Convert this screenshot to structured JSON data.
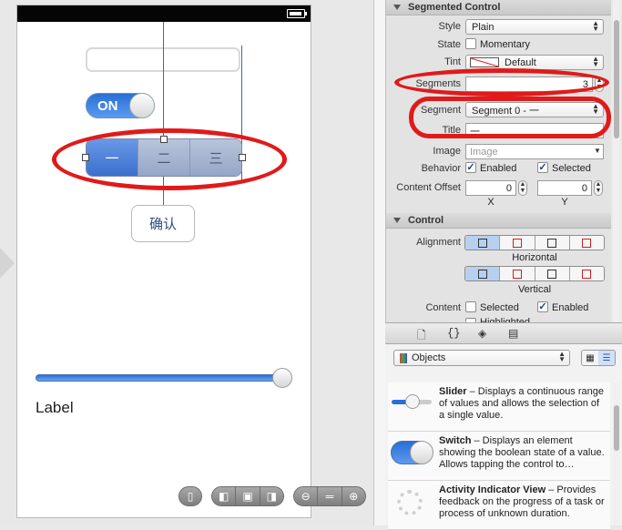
{
  "canvas": {
    "textfield_value": "",
    "switch_label": "ON",
    "segments": [
      "一",
      "二",
      "三"
    ],
    "selected_segment": 0,
    "confirm_label": "确认",
    "slider_value": 1.0,
    "label_text": "Label"
  },
  "zoom_bar": {
    "groups": [
      [
        "device-icon"
      ],
      [
        "layout-left-icon",
        "layout-fit-icon",
        "layout-right-icon"
      ],
      [
        "zoom-out-icon",
        "zoom-actual-icon",
        "zoom-in-icon"
      ]
    ]
  },
  "inspector": {
    "segmented_section": "Segmented Control",
    "style_label": "Style",
    "style_value": "Plain",
    "state_label": "State",
    "momentary_label": "Momentary",
    "tint_label": "Tint",
    "tint_value": "Default",
    "segments_label": "Segments",
    "segments_value": "3",
    "segment_label": "Segment",
    "segment_value": "Segment 0 - 一",
    "title_label": "Title",
    "title_value": "一",
    "image_label": "Image",
    "image_placeholder": "Image",
    "behavior_label": "Behavior",
    "enabled_label": "Enabled",
    "selected_label": "Selected",
    "content_offset_label": "Content Offset",
    "offset_x": "0",
    "offset_y": "0",
    "x_label": "X",
    "y_label": "Y",
    "control_section": "Control",
    "alignment_label": "Alignment",
    "horizontal_label": "Horizontal",
    "vertical_label": "Vertical",
    "content_label": "Content",
    "content_selected_label": "Selected",
    "content_enabled_label": "Enabled",
    "content_highlighted_label": "Highlighted"
  },
  "library": {
    "objects_label": "Objects",
    "items": [
      {
        "name": "Slider",
        "desc": " – Displays a continuous range of values and allows the selection of a single value."
      },
      {
        "name": "Switch",
        "desc": " – Displays an element showing the boolean state of a value. Allows tapping the control to…"
      },
      {
        "name": "Activity Indicator View",
        "desc": " – Provides feedback on the progress of a task or process of unknown duration."
      }
    ]
  },
  "colors": {
    "annotation_red": "#e01a1a",
    "ios_blue": "#2a6fd6"
  }
}
